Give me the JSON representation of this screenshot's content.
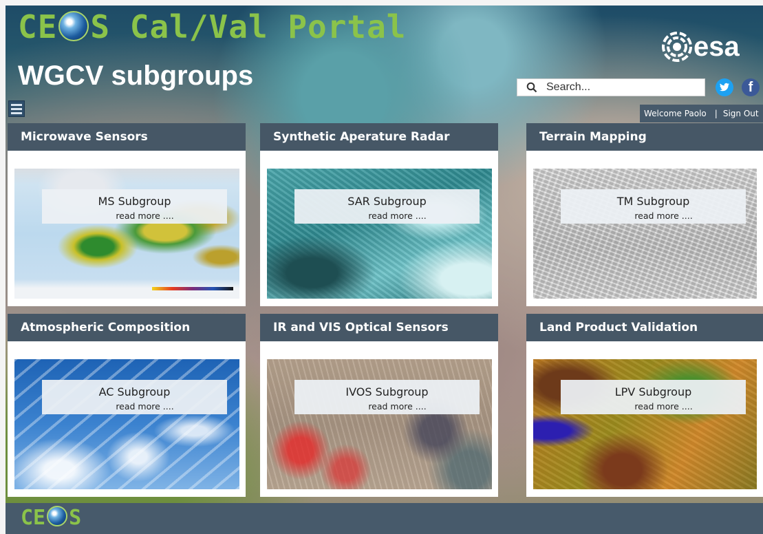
{
  "header": {
    "portal_title_before": "CE",
    "portal_title_after": "S Cal/Val Portal",
    "page_title": "WGCV subgroups",
    "esa_logo_text": "esa"
  },
  "search": {
    "placeholder": "Search...",
    "value": ""
  },
  "social": {
    "twitter_icon": "twitter-icon",
    "facebook_icon": "facebook-icon",
    "facebook_glyph": "f"
  },
  "user": {
    "welcome": "Welcome Paolo",
    "separator": "|",
    "sign_out": "Sign Out"
  },
  "cards": [
    {
      "header": "Microwave Sensors",
      "title": "MS Subgroup",
      "more": "read more ...."
    },
    {
      "header": "Synthetic Aperature Radar",
      "title": "SAR Subgroup",
      "more": "read more ...."
    },
    {
      "header": "Terrain Mapping",
      "title": "TM Subgroup",
      "more": "read more ...."
    },
    {
      "header": "Atmospheric Composition",
      "title": "AC Subgroup",
      "more": "read more ...."
    },
    {
      "header": "IR and VIS Optical Sensors",
      "title": "IVOS Subgroup",
      "more": "read more ...."
    },
    {
      "header": "Land Product Validation",
      "title": "LPV Subgroup",
      "more": "read more ...."
    }
  ],
  "footer": {
    "logo_before": "CE",
    "logo_after": "S"
  },
  "colors": {
    "accent_green": "#8bc34a",
    "header_slate": "#465766",
    "twitter_blue": "#1da1f2",
    "facebook_blue": "#3b5998"
  }
}
